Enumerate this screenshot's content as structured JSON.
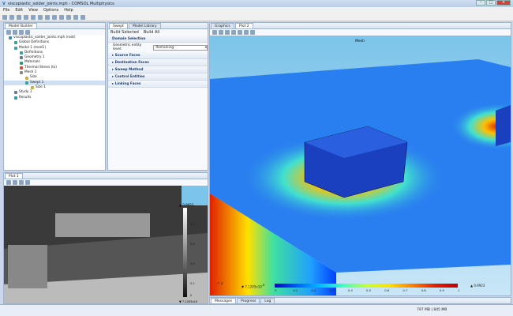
{
  "window": {
    "title": "viscoplastic_solder_joints.mph - COMSOL Multiphysics",
    "controls": [
      "minimize",
      "maximize",
      "close"
    ]
  },
  "menu": [
    "File",
    "Edit",
    "View",
    "Options",
    "Help"
  ],
  "model_builder": {
    "tab": "Model Builder",
    "tree": [
      {
        "label": "viscoplastic_solder_joints.mph (root)",
        "depth": 0,
        "color": "#3a8fb0"
      },
      {
        "label": "Global Definitions",
        "depth": 1,
        "color": "#3aa0a0"
      },
      {
        "label": "Model 1 (mod1)",
        "depth": 1,
        "color": "#3aa0a0"
      },
      {
        "label": "Definitions",
        "depth": 2,
        "color": "#3aa0a0"
      },
      {
        "label": "Geometry 1",
        "depth": 2,
        "color": "#6a7a9a"
      },
      {
        "label": "Materials",
        "depth": 2,
        "color": "#2a9a7a"
      },
      {
        "label": "Thermal Stress (ts)",
        "depth": 2,
        "color": "#d05030"
      },
      {
        "label": "Mesh 1",
        "depth": 2,
        "color": "#8a8a8a"
      },
      {
        "label": "Size",
        "depth": 3,
        "color": "#c8b040"
      },
      {
        "label": "Swept 1",
        "depth": 3,
        "color": "#40a0a0",
        "selected": true
      },
      {
        "label": "Size 1",
        "depth": 4,
        "color": "#c8b040"
      },
      {
        "label": "Study 1",
        "depth": 1,
        "color": "#6a7a9a"
      },
      {
        "label": "Results",
        "depth": 1,
        "color": "#3a8fb0"
      }
    ]
  },
  "settings": {
    "tabs": [
      "Swept",
      "Model Library"
    ],
    "build_selected": "Build Selected",
    "build_all": "Build All",
    "domain_selection": "Domain Selection",
    "entity_level_label": "Geometric entity level:",
    "entity_level_value": "Remaining",
    "sections": [
      "Source Faces",
      "Destination Faces",
      "Sweep Method",
      "Control Entities",
      "Linking Faces"
    ]
  },
  "graphics": {
    "tabs": [
      "Graphics",
      "Plot 2"
    ],
    "plot_title": "Mesh",
    "colorbar": {
      "min_label": "7.1205x10",
      "min_exp": "-8",
      "max_label": "0.9923",
      "ticks": [
        "0",
        "0.1",
        "0.2",
        "0.3",
        "0.4",
        "0.5",
        "0.6",
        "0.7",
        "0.8",
        "0.9",
        "1"
      ],
      "colors": [
        "#0000c8",
        "#0060ff",
        "#00c0ff",
        "#40ffc0",
        "#c0ff40",
        "#ffe000",
        "#ff8000",
        "#e02000",
        "#c00000"
      ]
    },
    "axes": [
      "z",
      "x",
      "y"
    ]
  },
  "plot1": {
    "tab": "Plot 1",
    "colorbar": {
      "max_label": "0.9923",
      "min_label": "7.1205x10",
      "min_exp": "-8",
      "ticks": [
        "0.8",
        "0.6",
        "0.4",
        "0.2",
        "0"
      ]
    }
  },
  "bottom": {
    "tabs": [
      "Messages",
      "Progress",
      "Log"
    ]
  },
  "status": {
    "memory": "797 MB | 845 MB"
  }
}
